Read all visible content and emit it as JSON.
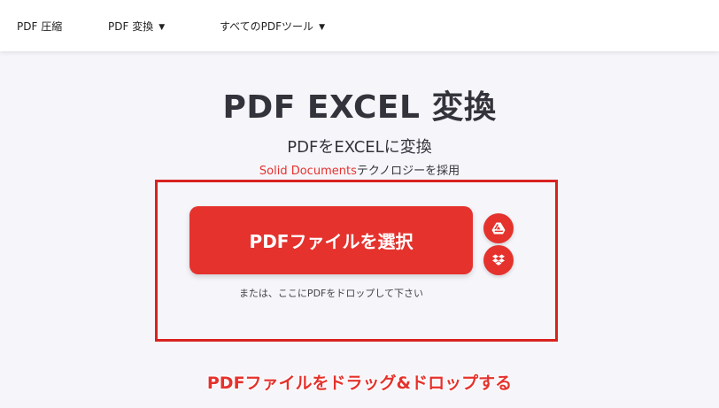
{
  "nav": {
    "items": [
      {
        "label": "PDF 圧縮",
        "has_caret": false
      },
      {
        "label": "PDF 変換",
        "has_caret": true
      },
      {
        "label": "すべてのPDFツール",
        "has_caret": true
      }
    ],
    "caret": "▼"
  },
  "main": {
    "title": "PDF EXCEL 変換",
    "subtitle": "PDFをEXCELに変換",
    "tech_link": "Solid Documents",
    "tech_suffix": "テクノロジーを採用",
    "select_button": "PDFファイルを選択",
    "drop_hint": "または、ここにPDFをドロップして下さい",
    "cloud_buttons": [
      {
        "icon": "google-drive-icon"
      },
      {
        "icon": "dropbox-icon"
      }
    ]
  },
  "annotation": {
    "caption": "PDFファイルをドラッグ&ドロップする",
    "color": "#e5322d"
  },
  "colors": {
    "accent": "#e5322d",
    "highlight_border": "#d9221f",
    "background": "#f5f5fa"
  }
}
